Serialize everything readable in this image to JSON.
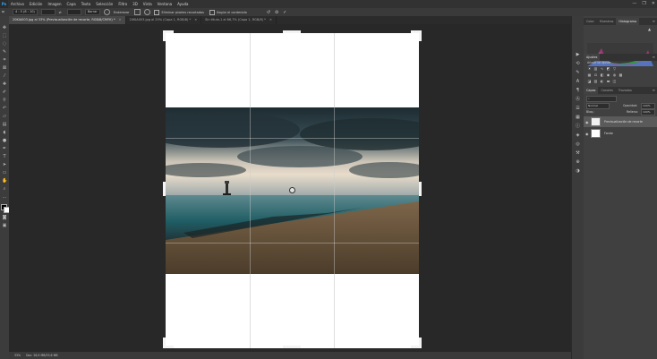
{
  "menu": {
    "logo": "Ps",
    "items": [
      "Archivo",
      "Edición",
      "Imagen",
      "Capa",
      "Texto",
      "Selección",
      "Filtro",
      "3D",
      "Vista",
      "Ventana",
      "Ayuda"
    ],
    "window_buttons": [
      "—",
      "❐",
      "✕"
    ]
  },
  "options": {
    "ratio": "4 : 5 (8 : 10)",
    "swap": "⇄",
    "clear_label": "Borrar",
    "straighten_label": "Enderezar",
    "delete_cropped_label": "Eliminar píxeles recortados",
    "content_aware_label": "Según el contenido",
    "reset_icon": "↺",
    "cancel_icon": "⊘",
    "commit_icon": "✓"
  },
  "tabs": [
    {
      "label": "20KIA003.jpg al 33% (Previsualización de recorte, RGB/8/CMYK) *",
      "active": true
    },
    {
      "label": "20KIA003.jpg al 25% (Capa 1, RGB/8) *",
      "active": false
    },
    {
      "label": "Sin título-1 al 66,7% (Capa 1, RGB/8) *",
      "active": false
    }
  ],
  "status": {
    "zoom": "33%",
    "doc": "Doc: 26,9 MB/53,6 MB"
  },
  "panels": {
    "top_tabs": [
      "Color",
      "Muestras",
      "Histograma"
    ],
    "top_active": 2,
    "mid_tabs": [
      "Ajustes"
    ],
    "adjust_hint": "Añadir un ajuste",
    "layer_tabs": [
      "Capas",
      "Canales",
      "Trazados"
    ],
    "layers_active": 0,
    "blend_mode": "Normal",
    "opacity_label": "Opacidad:",
    "opacity_value": "100%",
    "fill_label": "Relleno:",
    "fill_value": "100%",
    "lock_label": "Bloq.:",
    "layers": [
      {
        "name": "Previsualización de recorte",
        "selected": true
      },
      {
        "name": "Fondo",
        "selected": false
      }
    ]
  },
  "colors": {
    "accent": "#31a8ff",
    "canvas_bg": "#282828",
    "panel_bg": "#404040"
  }
}
